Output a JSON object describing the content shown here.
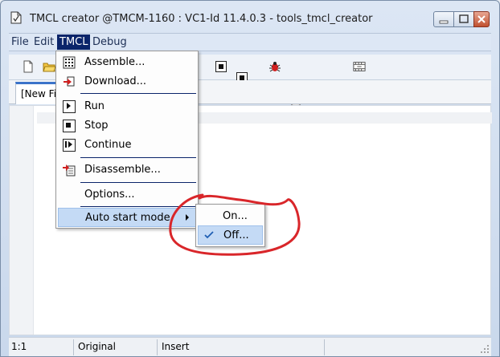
{
  "window": {
    "title": "TMCL creator @TMCM-1160 : VC1-Id 11.4.0.3 - tools_tmcl_creator"
  },
  "menubar": {
    "file": "File",
    "edit": "Edit",
    "tmcl": "TMCL",
    "debug": "Debug"
  },
  "editor": {
    "tab_label": "[New File]"
  },
  "tmcl_menu": {
    "assemble": "Assemble...",
    "download": "Download...",
    "run": "Run",
    "stop": "Stop",
    "continue": "Continue",
    "disassemble": "Disassemble...",
    "options": "Options...",
    "auto_start_mode": "Auto start mode"
  },
  "auto_start_submenu": {
    "on": "On...",
    "off": "Off...",
    "checked_item": "off"
  },
  "statusbar": {
    "position": "1:1",
    "mode": "Original",
    "insert": "Insert"
  },
  "colors": {
    "menu_highlight": "#0a246a",
    "menu_hover": "#c4daf5",
    "annotation": "#d9262a",
    "tab_accent": "#3b73c9"
  }
}
